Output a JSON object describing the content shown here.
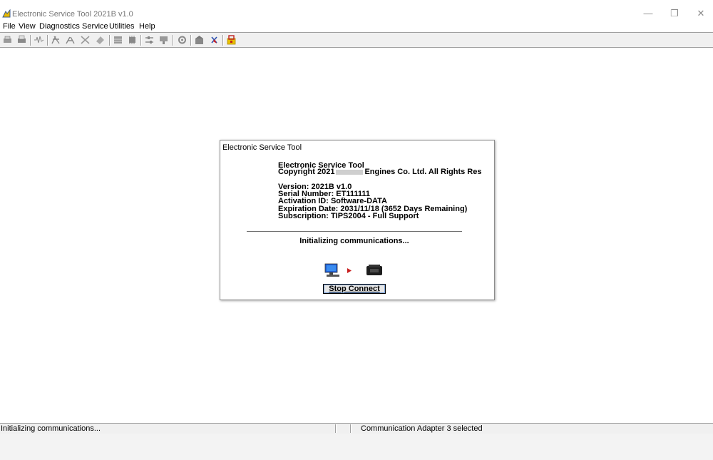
{
  "window": {
    "title": "Electronic Service Tool 2021B v1.0",
    "minimize_glyph": "—",
    "restore_glyph": "❐",
    "close_glyph": "✕"
  },
  "menu": [
    "File",
    "View",
    "Diagnostics",
    "Service",
    "Utilities",
    "Help"
  ],
  "toolbar": {
    "icons": [
      "print-icon",
      "print-preview-icon",
      "waveform-icon",
      "connect-icon",
      "disconnect-icon",
      "tool-icon",
      "flash-icon",
      "book-icon",
      "module-icon",
      "settings-icon",
      "config-icon",
      "gear-icon",
      "building-icon",
      "compass-icon",
      "lock-icon"
    ]
  },
  "dialog": {
    "title": "Electronic Service Tool",
    "product": "Electronic Service Tool",
    "copyright_prefix": "Copyright 2021",
    "copyright_suffix": "Engines Co. Ltd.  All Rights Reser",
    "version": "Version:  2021B v1.0",
    "serial": "Serial Number:  ET111111",
    "activation": "Activation ID:  Software-DATA",
    "expiration": "Expiration Date:  2031/11/18 (3652 Days Remaining)",
    "subscription": "Subscription:  TIPS2004 - Full Support",
    "message": "Initializing communications...",
    "stop_button": "Stop Connect"
  },
  "statusbar": {
    "left": "Initializing communications...",
    "right": "Communication Adapter 3 selected"
  },
  "colors": {
    "titlebar": "#ffffff",
    "workspace": "#ffffff",
    "chrome": "#f0f0f0",
    "button_focus": "#7aa0d6"
  }
}
